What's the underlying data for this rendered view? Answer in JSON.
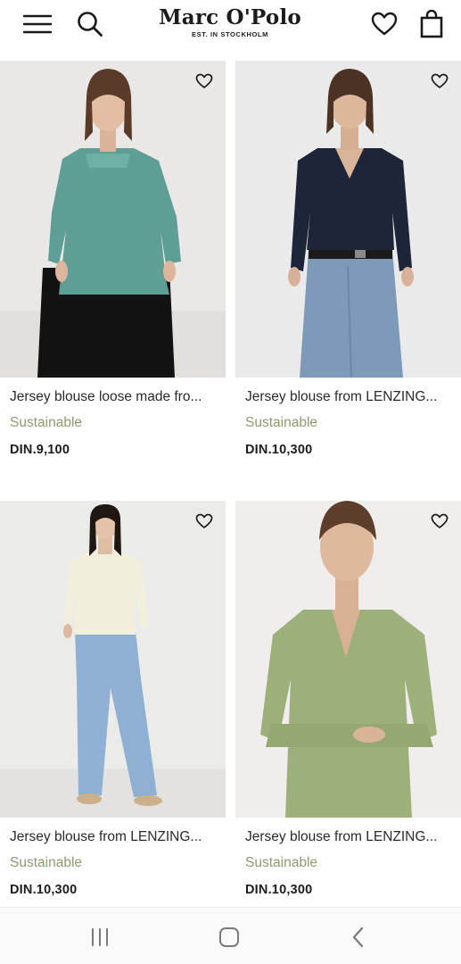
{
  "header": {
    "logo_text": "Marc O'Polo",
    "logo_subtitle": "EST. IN STOCKHOLM"
  },
  "products": [
    {
      "title": "Jersey blouse loose made fro...",
      "tag": "Sustainable",
      "price": "DIN.9,100"
    },
    {
      "title": "Jersey blouse from LENZING...",
      "tag": "Sustainable",
      "price": "DIN.10,300"
    },
    {
      "title": "Jersey blouse from LENZING...",
      "tag": "Sustainable",
      "price": "DIN.10,300"
    },
    {
      "title": "Jersey blouse from LENZING...",
      "tag": "Sustainable",
      "price": "DIN.10,300"
    }
  ],
  "icons": {
    "menu": "hamburger-menu-icon",
    "search": "search-icon",
    "wishlist": "heart-icon",
    "bag": "shopping-bag-icon",
    "favorite": "heart-outline-icon",
    "nav_recent": "recent-apps-icon",
    "nav_home": "home-icon",
    "nav_back": "back-icon"
  },
  "colors": {
    "tag": "#8b9a6f",
    "image_bg": "#ececec",
    "text": "#2a2a2a"
  }
}
